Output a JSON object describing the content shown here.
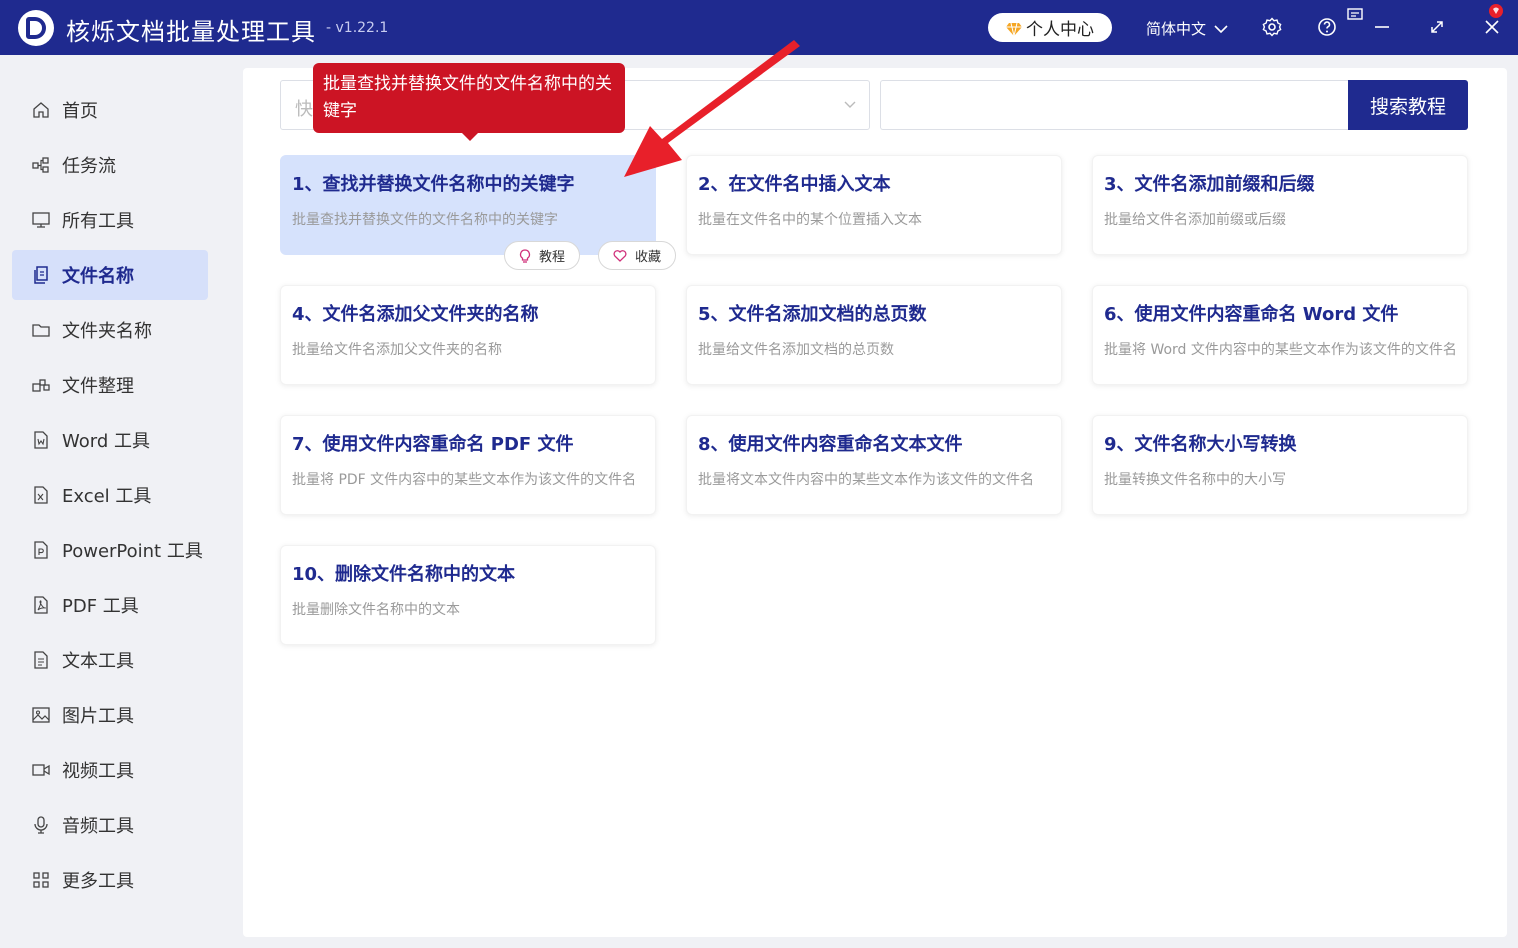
{
  "app": {
    "title": "核烁文档批量处理工具",
    "version": "- v1.22.1",
    "user_center": "个人中心",
    "language": "简体中文"
  },
  "sidebar": {
    "items": [
      {
        "label": "首页",
        "icon": "home-icon"
      },
      {
        "label": "任务流",
        "icon": "flow-icon"
      },
      {
        "label": "所有工具",
        "icon": "monitor-icon"
      },
      {
        "label": "文件名称",
        "icon": "file-copy-icon",
        "active": true
      },
      {
        "label": "文件夹名称",
        "icon": "folder-icon"
      },
      {
        "label": "文件整理",
        "icon": "organize-icon"
      },
      {
        "label": "Word 工具",
        "icon": "word-icon"
      },
      {
        "label": "Excel 工具",
        "icon": "excel-icon"
      },
      {
        "label": "PowerPoint 工具",
        "icon": "ppt-icon"
      },
      {
        "label": "PDF 工具",
        "icon": "pdf-icon"
      },
      {
        "label": "文本工具",
        "icon": "text-icon"
      },
      {
        "label": "图片工具",
        "icon": "image-icon"
      },
      {
        "label": "视频工具",
        "icon": "video-icon"
      },
      {
        "label": "音频工具",
        "icon": "mic-icon"
      },
      {
        "label": "更多工具",
        "icon": "grid-icon"
      }
    ]
  },
  "search": {
    "select_placeholder": "快",
    "input_value": "",
    "button_label": "搜索教程"
  },
  "tooltip": {
    "text": "批量查找并替换文件的文件名称中的关键字"
  },
  "cards": [
    {
      "title": "1、查找并替换文件名称中的关键字",
      "desc": "批量查找并替换文件的文件名称中的关键字"
    },
    {
      "title": "2、在文件名中插入文本",
      "desc": "批量在文件名中的某个位置插入文本"
    },
    {
      "title": "3、文件名添加前缀和后缀",
      "desc": "批量给文件名添加前缀或后缀"
    },
    {
      "title": "4、文件名添加父文件夹的名称",
      "desc": "批量给文件名添加父文件夹的名称"
    },
    {
      "title": "5、文件名添加文档的总页数",
      "desc": "批量给文件名添加文档的总页数"
    },
    {
      "title": "6、使用文件内容重命名 Word 文件",
      "desc": "批量将 Word 文件内容中的某些文本作为该文件的文件名"
    },
    {
      "title": "7、使用文件内容重命名 PDF 文件",
      "desc": "批量将 PDF 文件内容中的某些文本作为该文件的文件名"
    },
    {
      "title": "8、使用文件内容重命名文本文件",
      "desc": "批量将文本文件内容中的某些文本作为该文件的文件名"
    },
    {
      "title": "9、文件名称大小写转换",
      "desc": "批量转换文件名称中的大小写"
    },
    {
      "title": "10、删除文件名称中的文本",
      "desc": "批量删除文件名称中的文本"
    }
  ],
  "card_actions": {
    "tutorial": "教程",
    "favorite": "收藏"
  },
  "colors": {
    "brand": "#1f2a8f",
    "active_bg": "#d6e0fa",
    "tooltip": "#cc1424",
    "arrow": "#e8202a"
  }
}
